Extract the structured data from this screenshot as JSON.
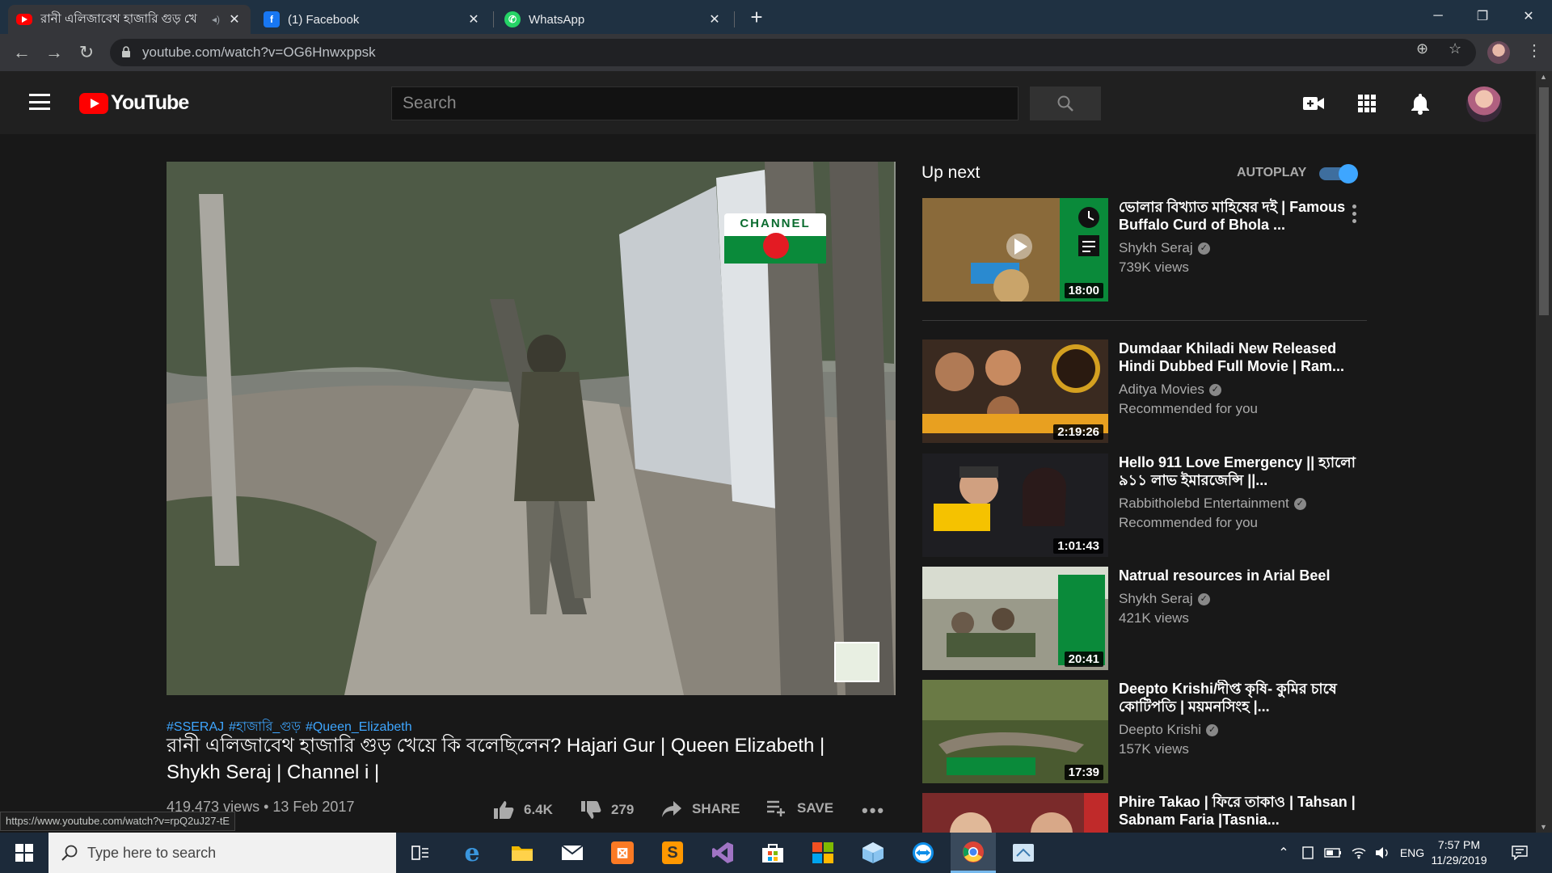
{
  "browser": {
    "tabs": [
      {
        "title": "রানী এলিজাবেথ হাজারি গুড় খে",
        "icon": "youtube-icon",
        "active": true
      },
      {
        "title": "(1) Facebook",
        "icon": "facebook-icon",
        "active": false
      },
      {
        "title": "WhatsApp",
        "icon": "whatsapp-icon",
        "active": false
      }
    ],
    "url": "youtube.com/watch?v=OG6Hnwxppsk",
    "status_url": "https://www.youtube.com/watch?v=rpQ2uJ27-tE"
  },
  "youtube": {
    "logo_text": "YouTube",
    "search_placeholder": "Search",
    "brand_color": "#ff0000",
    "link_color": "#3ea6ff"
  },
  "video": {
    "hashtags": [
      "#SSERAJ",
      "#হাজারি_গুড়",
      "#Queen_Elizabeth"
    ],
    "title": "রানী এলিজাবেথ হাজারি গুড় খেয়ে কি বলেছিলেন? Hajari Gur | Queen Elizabeth | Shykh Seraj | Channel i |",
    "meta": "419,473 views • 13 Feb 2017",
    "likes": "6.4K",
    "dislikes": "279",
    "share_label": "SHARE",
    "save_label": "SAVE",
    "overlay_channel_text": "CHANNEL"
  },
  "upnext": {
    "heading": "Up next",
    "autoplay_label": "AUTOPLAY",
    "autoplay_on": true,
    "items": [
      {
        "title": "ভোলার বিখ্যাত মাহিষের দই | Famous Buffalo Curd of Bhola ...",
        "channel": "Shykh Seraj",
        "views": "739K views",
        "duration": "18:00"
      },
      {
        "title": "Dumdaar Khiladi New Released Hindi Dubbed Full Movie | Ram...",
        "channel": "Aditya Movies",
        "views": "Recommended for you",
        "duration": "2:19:26"
      },
      {
        "title": "Hello 911 Love Emergency || হ্যালো ৯১১ লাভ ইমারজেন্সি ||...",
        "channel": "Rabbitholebd Entertainment",
        "views": "Recommended for you",
        "duration": "1:01:43"
      },
      {
        "title": "Natrual resources in Arial Beel",
        "channel": "Shykh Seraj",
        "views": "421K views",
        "duration": "20:41"
      },
      {
        "title": "Deepto Krishi/দীপ্ত কৃষি- কুমির চাষে কোটিপতি | ময়মনসিংহ |...",
        "channel": "Deepto Krishi",
        "views": "157K views",
        "duration": "17:39"
      },
      {
        "title": "Phire Takao | ফিরে তাকাও | Tahsan | Sabnam Faria |Tasnia...",
        "channel": "",
        "views": "",
        "duration": ""
      }
    ]
  },
  "taskbar": {
    "search_placeholder": "Type here to search",
    "language": "ENG",
    "time": "7:57 PM",
    "date": "11/29/2019"
  }
}
